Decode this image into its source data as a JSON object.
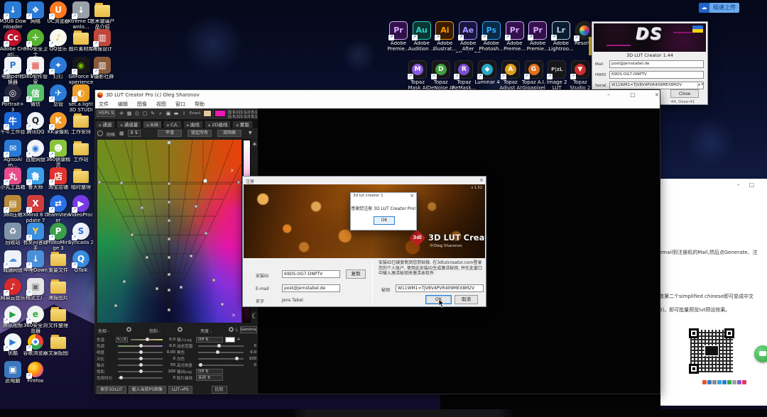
{
  "quick_upload": {
    "label": "极速上传"
  },
  "glyphs": {
    "minimize": "–",
    "maximize": "□",
    "close": "×",
    "shortcut_arrow": "↗",
    "sun": "☀",
    "moon": "☾",
    "dropdown": "▼",
    "spin": "⇅",
    "cross": "✕"
  },
  "keygen": {
    "brand": "DS",
    "title": "3D LUT Creator 1.44",
    "fields": [
      {
        "label": "Mail",
        "value": "post@jernstabel.de",
        "spinner": false
      },
      {
        "label": "HWID",
        "value": "69DS-OG7-DNPTV",
        "spinner": false
      },
      {
        "label": "Serial",
        "value": "W11WM1=TJV8V4PVR409MEX8M2V",
        "spinner": true
      }
    ],
    "close_label": "Close",
    "status": "44, Dose-41"
  },
  "app": {
    "title": "3D LUT Creator Pro (c) Oleg Sharonov",
    "menus": [
      "文件",
      "编辑",
      "图像",
      "视图",
      "窗口",
      "帮助"
    ],
    "toolbar": {
      "mode": "HSPs",
      "tool_icons": [
        "✛",
        "▦",
        "⟨⟩",
        "▢",
        "✎",
        "⌕",
        "▣",
        "▬",
        "I"
      ],
      "exact": "Exact",
      "swatch1": "#e9c6a0",
      "swatch2": "#ec18b4",
      "readout": [
        {
          "tag": "前",
          "text": "R:221  G:0  B:175"
        },
        {
          "tag": "后",
          "text": "R:221  G:0  B:175"
        }
      ]
    },
    "tabs": [
      "通道",
      "通道量",
      "A/B",
      "C/L",
      "曲线",
      "2D曲线",
      "蒙版"
    ],
    "active_tab": "A/B",
    "grid_controls": {
      "grid_label": "网格",
      "size": "8",
      "buttons": [
        "平滑",
        "锁定所有",
        "双网格"
      ]
    },
    "hue_row": [
      "色相 -",
      "饱和 -",
      "亮度 -"
    ],
    "gamma_prefix": "L",
    "gamma_label": "Gamma",
    "sliders_left": [
      {
        "label": "色温",
        "value": "0.0",
        "pos": 0.5,
        "track": "temp",
        "tools": true
      },
      {
        "label": "色调",
        "value": "0.0",
        "pos": 0.5,
        "track": "tint"
      },
      {
        "label": "明度",
        "value": "0.00",
        "pos": 0.5
      },
      {
        "label": "对比",
        "value": "0",
        "pos": 0.5
      },
      {
        "label": "轴点",
        "value": "50",
        "pos": 0.5
      },
      {
        "label": "饱和",
        "value": "100",
        "pos": 0.5
      },
      {
        "label": "色相均匀",
        "value": "0",
        "pos": 0.07
      }
    ],
    "sliders_right": [
      {
        "label": "输入Log",
        "select": "Off",
        "swatch": "#ffffff",
        "abtn": "A"
      },
      {
        "label": "动态范围",
        "value": "0",
        "pos": 0.45
      },
      {
        "label": "黑色",
        "value": "0.0",
        "pos": 0.42
      },
      {
        "label": "白色",
        "value": "100",
        "pos": 0.85
      },
      {
        "label": "高光恢复",
        "value": "0",
        "pos": 0.05
      },
      {
        "label": "输出Log",
        "select": "Off"
      },
      {
        "label": "胶片曲线",
        "select": "关闭"
      }
    ],
    "bottom_buttons": [
      "保存3DLUT",
      "载入当前PS图像",
      "LUT→PS"
    ],
    "compare_label": "比较"
  },
  "reg_dialog": {
    "title": "注册",
    "version": "v 1.52",
    "logo": "3dl",
    "brand": "3D LUT Creator",
    "copyright": "©Oleg Sharonov",
    "install_id_label": "安装ID",
    "install_id": "69DS-OG7-DNPTV",
    "copy_label": "复制",
    "email_label": "E-mail",
    "email": "post@jernstabel.de",
    "name_label": "名字",
    "name": "Jens Tabel",
    "instructions": "安装ID已被复制到您剪贴板. 在3dlutcreator.com登录您的个人账户, 使用此安装ID生成激活秘钥, 并在此窗口中输入激活秘钥来激活本软件.",
    "key_label": "秘钥",
    "key": "W11WM1=TJV8V4PVR409MEX8M2V",
    "ok_label": "OK",
    "cancel_label": "取消"
  },
  "popup": {
    "title": "3d lut creator 1",
    "message": "感谢您注册 3D LUT Creator Pro!",
    "ok_label": "OK"
  },
  "doc": {
    "lines": [
      "email到注册机的Mail,然后点Generate、注",
      "数第二个simplified chinese即可变成中文",
      "3)，即可批量预览lut预设效果。"
    ],
    "toolbar_colors": [
      "#e0562a",
      "#2a7fd4",
      "#8a8a8a",
      "#3aa0e0",
      "#2a7fd4",
      "#35a845",
      "#9aa0a8",
      "#8a5ad0",
      "#e03a6a"
    ]
  },
  "adobe_icons": [
    {
      "label": "Adobe Premie...",
      "abbr": "Pr",
      "bg": "#32104a",
      "fg": "#d7a9ff"
    },
    {
      "label": "Adobe Audition ...",
      "abbr": "Au",
      "bg": "#0b3733",
      "fg": "#2bd4c4"
    },
    {
      "label": "Adobe Illustrat...",
      "abbr": "Ai",
      "bg": "#391c00",
      "fg": "#ff9a00"
    },
    {
      "label": "Adobe After Effects CC ...",
      "abbr": "Ae",
      "bg": "#1c1440",
      "fg": "#a49aff"
    },
    {
      "label": "Adobe Photosh...",
      "abbr": "Ps",
      "bg": "#0b2a44",
      "fg": "#31a8ff"
    },
    {
      "label": "Adobe Premie...",
      "abbr": "Pr",
      "bg": "#32104a",
      "fg": "#d7a9ff"
    },
    {
      "label": "Adobe Premie...",
      "abbr": "Pr",
      "bg": "#32104a",
      "fg": "#d7a9ff"
    },
    {
      "label": "Adobe Lightroo...",
      "abbr": "Lr",
      "bg": "#0a1c2e",
      "fg": "#b7d6ea"
    },
    {
      "label": "Resolve",
      "abbr": "",
      "kind": "resolve"
    }
  ],
  "topaz_icons": [
    {
      "label": "Topaz Mask AI",
      "glyph": "M",
      "color": "#8a5ae0"
    },
    {
      "label": "Topaz DeNoise AI",
      "glyph": "D",
      "color": "#3f9f3f"
    },
    {
      "label": "Topaz ReMask...",
      "glyph": "R",
      "color": "#7a4fd0"
    },
    {
      "label": "Luminar 4",
      "glyph": "◆",
      "color": "#2aa8c4"
    },
    {
      "label": "Topaz Adjust AI",
      "glyph": "A",
      "color": "#e0a020"
    },
    {
      "label": "Topaz A.I. Gigapixel",
      "glyph": "G",
      "color": "#e07020"
    },
    {
      "label": "Image 2 LUT",
      "glyph": "P|zL",
      "color": "#cfcfcf",
      "kind": "text"
    },
    {
      "label": "Topaz Studio 2",
      "glyph": "▼",
      "color": "#d03030"
    }
  ],
  "desktop_icons": [
    {
      "r": 1,
      "c": 1,
      "t": "M3U8 Downloader",
      "g": "↓",
      "b": "#2b7bd6"
    },
    {
      "r": 2,
      "c": 1,
      "t": "Adobe Creati...",
      "g": "Cc",
      "b": "#c0122a",
      "k": "circle"
    },
    {
      "r": 3,
      "c": 1,
      "t": "电脑pdf转换器",
      "g": "P",
      "b": "#f2f4f8",
      "f": "#2b7bd6"
    },
    {
      "r": 4,
      "c": 1,
      "t": "Portrait+ 3",
      "g": "◎",
      "b": "#23233a",
      "k": "circle"
    },
    {
      "r": 5,
      "c": 1,
      "t": "千牛工作台",
      "g": "牛",
      "b": "#1b66d6"
    },
    {
      "r": 6,
      "c": 1,
      "t": "AgisoAlm...",
      "g": "✉",
      "b": "#2b7bd6"
    },
    {
      "r": 7,
      "c": 1,
      "t": "小丸工具箱",
      "g": "丸",
      "b": "#e84a8a"
    },
    {
      "r": 8,
      "c": 1,
      "t": "360压缩",
      "g": "▤",
      "b": "#b8893a"
    },
    {
      "r": 9,
      "c": 1,
      "t": "回收站",
      "g": "♻",
      "b": "#8095aa",
      "k": "sys"
    },
    {
      "r": 10,
      "c": 1,
      "t": "城通网盘",
      "g": "☁",
      "b": "#eef2f8",
      "f": "#4a90d9"
    },
    {
      "r": 11,
      "c": 1,
      "t": "网易云音乐",
      "g": "♪",
      "b": "#d82a2a",
      "k": "circle"
    },
    {
      "r": 12,
      "c": 1,
      "t": "腾讯视频",
      "g": "▶",
      "b": "#f2f6fa",
      "f": "#28a03c",
      "k": "circle"
    },
    {
      "r": 13,
      "c": 1,
      "t": "优酷",
      "g": "▶",
      "b": "#f2f6fa",
      "f": "#2a7fd4",
      "k": "circle"
    },
    {
      "r": 14,
      "c": 1,
      "t": "此电脑",
      "g": "▣",
      "b": "#3a78c0",
      "k": "sys"
    },
    {
      "r": 1,
      "c": 2,
      "t": "网络",
      "g": "❖",
      "b": "#2b7bd6"
    },
    {
      "r": 2,
      "c": 2,
      "t": "360安全卫士",
      "g": "✛",
      "b": "#58b431",
      "k": "circle"
    },
    {
      "r": 3,
      "c": 2,
      "t": "360软件管家",
      "g": "▦",
      "b": "#f2f2f2",
      "f": "#e8443a"
    },
    {
      "r": 4,
      "c": 2,
      "t": "微信",
      "g": "信",
      "b": "#57be6a"
    },
    {
      "r": 5,
      "c": 2,
      "t": "腾讯QQ",
      "g": "Q",
      "b": "#f0f4f8",
      "f": "#20242a",
      "k": "circle"
    },
    {
      "r": 6,
      "c": 2,
      "t": "百度网盘",
      "g": "◉",
      "b": "#f0f4fa",
      "f": "#2b7bd6",
      "k": "circle"
    },
    {
      "r": 7,
      "c": 2,
      "t": "鲁大师",
      "g": "鲁",
      "b": "#3aa0e8"
    },
    {
      "r": 8,
      "c": 2,
      "t": "XMind 8 Update 7",
      "g": "X",
      "b": "#d23c3c"
    },
    {
      "r": 9,
      "c": 2,
      "t": "有奖问答助手",
      "g": "Y",
      "b": "#3a8fe0",
      "f": "#ffd24a"
    },
    {
      "r": 10,
      "c": 2,
      "t": "哔哩Down",
      "g": "↓",
      "b": "#4a90d9"
    },
    {
      "r": 11,
      "c": 2,
      "t": "格式工厂",
      "g": "▣",
      "b": "#e6e6e6",
      "f": "#707070"
    },
    {
      "r": 12,
      "c": 2,
      "t": "360安全浏览器",
      "g": "e",
      "b": "#eef4ee",
      "f": "#35a845",
      "k": "circle"
    },
    {
      "r": 13,
      "c": 2,
      "t": "谷歌浏览器",
      "g": "",
      "b": "",
      "k": "chrome"
    },
    {
      "r": 14,
      "c": 2,
      "t": "Firefox",
      "g": "",
      "b": "",
      "k": "firefox"
    },
    {
      "r": 1,
      "c": 3,
      "t": "UC浏览器",
      "g": "U",
      "b": "#ff7a1e",
      "k": "circle"
    },
    {
      "r": 2,
      "c": 3,
      "t": "QQ音乐",
      "g": "♪",
      "b": "#f8f8f0",
      "f": "#f0b518",
      "k": "circle"
    },
    {
      "r": 3,
      "c": 3,
      "t": "灯灯",
      "g": "✦",
      "b": "#2b7bd6",
      "k": "circle"
    },
    {
      "r": 4,
      "c": 3,
      "t": "总管",
      "g": "✈",
      "b": "#2b7bd6",
      "k": "circle"
    },
    {
      "r": 5,
      "c": 3,
      "t": "KK录像机",
      "g": "K",
      "b": "#f09a2a",
      "k": "circle"
    },
    {
      "r": 6,
      "c": 3,
      "t": "360健康精灵",
      "g": "☻",
      "b": "#8ac43e"
    },
    {
      "r": 7,
      "c": 3,
      "t": "淘宝店铺",
      "g": "店",
      "b": "#e2332e"
    },
    {
      "r": 8,
      "c": 3,
      "t": "TeamViewer",
      "g": "⇄",
      "b": "#2a6fe8",
      "k": "circle"
    },
    {
      "r": 9,
      "c": 3,
      "t": "PhotoMirage 3",
      "g": "P",
      "b": "#3aa04a",
      "k": "circle"
    },
    {
      "r": 10,
      "c": 3,
      "t": "重要文件",
      "g": "",
      "b": "",
      "k": "folder"
    },
    {
      "r": 11,
      "c": 3,
      "t": "海报图片",
      "g": "",
      "b": "",
      "k": "folder"
    },
    {
      "r": 12,
      "c": 3,
      "t": "文件整理",
      "g": "",
      "b": "",
      "k": "folder"
    },
    {
      "r": 13,
      "c": 3,
      "t": "文案配图",
      "g": "",
      "b": "",
      "k": "folder"
    },
    {
      "r": 1,
      "c": 4,
      "t": "Xtreme Downlo...",
      "g": "↓",
      "b": "#9aa0a8"
    },
    {
      "r": 2,
      "c": 4,
      "t": "图片素材库",
      "g": "",
      "b": "",
      "k": "folder"
    },
    {
      "r": 3,
      "c": 4,
      "t": "GeForce Experience",
      "g": "◉",
      "b": "#16181a",
      "f": "#76b900"
    },
    {
      "r": 4,
      "c": 4,
      "t": "set.a.light 3D STUDIO",
      "g": "◐",
      "b": "#f0a02a"
    },
    {
      "r": 5,
      "c": 4,
      "t": "工作安排",
      "g": "",
      "b": "",
      "k": "folder"
    },
    {
      "r": 6,
      "c": 4,
      "t": "工作站",
      "g": "",
      "b": "",
      "k": "folder"
    },
    {
      "r": 7,
      "c": 4,
      "t": "临时整理",
      "g": "",
      "b": "",
      "k": "folder"
    },
    {
      "r": 8,
      "c": 4,
      "t": "VideoProc",
      "g": "▶",
      "b": "#7a3ae8",
      "k": "circle"
    },
    {
      "r": 9,
      "c": 4,
      "t": "Syncaila 2",
      "g": "S",
      "b": "#f0f4fa",
      "f": "#2a6fd4",
      "k": "circle"
    },
    {
      "r": 10,
      "c": 4,
      "t": "QTalk",
      "g": "Q",
      "b": "#3a8fe0",
      "k": "circle"
    },
    {
      "r": 1,
      "c": 5,
      "t": "艺术玻璃产品介绍",
      "g": "",
      "b": "",
      "k": "folder"
    },
    {
      "r": 2,
      "c": 5,
      "t": "海报设计",
      "g": "▥",
      "b": "#c0473c"
    },
    {
      "r": 3,
      "c": 5,
      "t": "V摄影社群",
      "g": "▥",
      "b": "#8a5a3a"
    }
  ]
}
